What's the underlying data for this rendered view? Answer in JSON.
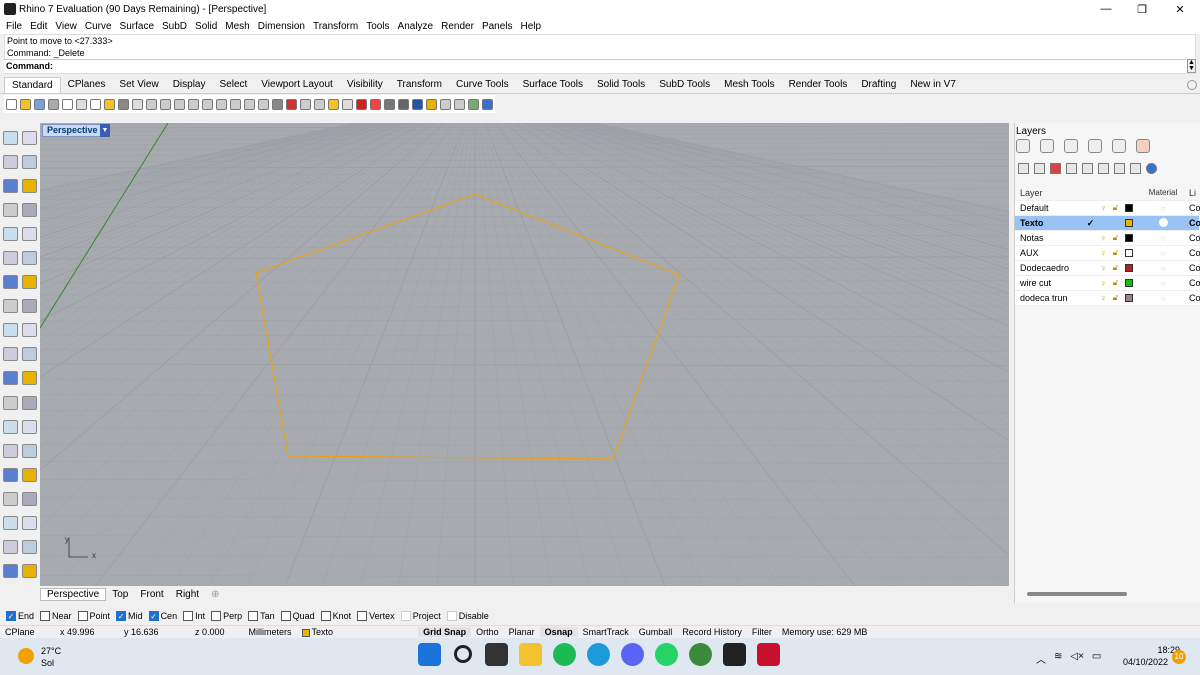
{
  "window": {
    "title": "Rhino 7 Evaluation (90 Days Remaining) - [Perspective]",
    "minimize": "—",
    "maximize": "❐",
    "close": "✕"
  },
  "menu": [
    "File",
    "Edit",
    "View",
    "Curve",
    "Surface",
    "SubD",
    "Solid",
    "Mesh",
    "Dimension",
    "Transform",
    "Tools",
    "Analyze",
    "Render",
    "Panels",
    "Help"
  ],
  "command": {
    "history": [
      "Point to move to <27.333>",
      "Command: _Delete"
    ],
    "prompt": "Command:"
  },
  "tabs": [
    "Standard",
    "CPlanes",
    "Set View",
    "Display",
    "Select",
    "Viewport Layout",
    "Visibility",
    "Transform",
    "Curve Tools",
    "Surface Tools",
    "Solid Tools",
    "SubD Tools",
    "Mesh Tools",
    "Render Tools",
    "Drafting",
    "New in V7"
  ],
  "viewport": {
    "label": "Perspective",
    "axis_y": "y",
    "axis_x": "x",
    "curve_color": "#e8a21a",
    "grid_color": "#9a9ea4",
    "bg_color": "#a7abb0"
  },
  "viewport_tabs": [
    "Perspective",
    "Top",
    "Front",
    "Right"
  ],
  "viewport_tab_add": "⊕",
  "layers": {
    "title": "Layers",
    "header": {
      "layer": "Layer",
      "material": "Material",
      "linetype": "Li"
    },
    "rows": [
      {
        "name": "Default",
        "current": false,
        "color": "#000000",
        "li": "Co"
      },
      {
        "name": "Texto",
        "current": true,
        "color": "#e8b200",
        "li": "Co"
      },
      {
        "name": "Notas",
        "current": false,
        "color": "#000000",
        "li": "Co"
      },
      {
        "name": "AUX",
        "current": false,
        "color": "#ffffff",
        "li": "Co"
      },
      {
        "name": "Dodecaedro",
        "current": false,
        "color": "#b02020",
        "li": "Co"
      },
      {
        "name": "wire cut",
        "current": false,
        "color": "#10c010",
        "li": "Co"
      },
      {
        "name": "dodeca trun",
        "current": false,
        "color": "#a08080",
        "li": "Co"
      }
    ]
  },
  "osnaps": [
    {
      "label": "End",
      "on": true
    },
    {
      "label": "Near",
      "on": false
    },
    {
      "label": "Point",
      "on": false
    },
    {
      "label": "Mid",
      "on": true
    },
    {
      "label": "Cen",
      "on": true
    },
    {
      "label": "Int",
      "on": false
    },
    {
      "label": "Perp",
      "on": false
    },
    {
      "label": "Tan",
      "on": false
    },
    {
      "label": "Quad",
      "on": false
    },
    {
      "label": "Knot",
      "on": false
    },
    {
      "label": "Vertex",
      "on": false
    },
    {
      "label": "Project",
      "on": false
    },
    {
      "label": "Disable",
      "on": false
    }
  ],
  "status": {
    "cplane": "CPlane",
    "x": "x 49.996",
    "y": "y 16.636",
    "z": "z 0.000",
    "units": "Millimeters",
    "layer": "Texto",
    "grid_snap": "Grid Snap",
    "ortho": "Ortho",
    "planar": "Planar",
    "osnap": "Osnap",
    "smarttrack": "SmartTrack",
    "gumball": "Gumball",
    "record_history": "Record History",
    "filter": "Filter",
    "memory": "Memory use: 629 MB"
  },
  "taskbar": {
    "temp": "27°C",
    "weather": "Sol",
    "time": "18:29",
    "date": "04/10/2022",
    "notifications": "10"
  }
}
